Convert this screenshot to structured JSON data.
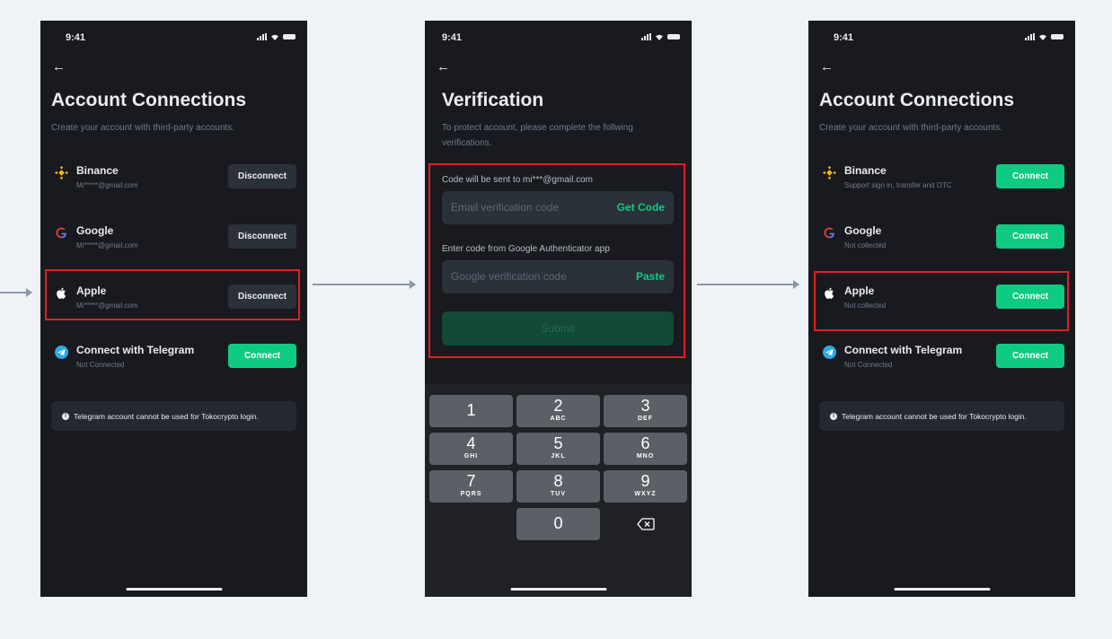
{
  "status_time": "9:41",
  "connections": {
    "title": "Account Connections",
    "subtitle": "Create your account with third-party accounts.",
    "notice": "Telegram account cannot be used for Tokocrypto login."
  },
  "screen1": {
    "accounts": [
      {
        "name": "Binance",
        "detail": "Mi*****@gmail.com",
        "button": "Disconnect",
        "icon": "binance-icon"
      },
      {
        "name": "Google",
        "detail": "Mi*****@gmail.com",
        "button": "Disconnect",
        "icon": "google-icon"
      },
      {
        "name": "Apple",
        "detail": "Mi*****@gmail.com",
        "button": "Disconnect",
        "icon": "apple-icon"
      },
      {
        "name": "Connect with Telegram",
        "detail": "Not Connected",
        "button": "Connect",
        "icon": "telegram-icon"
      }
    ]
  },
  "screen2": {
    "title": "Verification",
    "subtitle": "To protect account, please complete the follwing verifications.",
    "email_label": "Code will be sent to mi***@gmail.com",
    "email_placeholder": "Email verification code",
    "email_action": "Get Code",
    "google_label": "Enter code from Google Authenticator app",
    "google_placeholder": "Google verification code",
    "google_action": "Paste",
    "submit": "Submit",
    "keys": [
      {
        "digit": "1",
        "letters": ""
      },
      {
        "digit": "2",
        "letters": "ABC"
      },
      {
        "digit": "3",
        "letters": "DEF"
      },
      {
        "digit": "4",
        "letters": "GHI"
      },
      {
        "digit": "5",
        "letters": "JKL"
      },
      {
        "digit": "6",
        "letters": "MNO"
      },
      {
        "digit": "7",
        "letters": "PQRS"
      },
      {
        "digit": "8",
        "letters": "TUV"
      },
      {
        "digit": "9",
        "letters": "WXYZ"
      },
      {
        "digit": "0",
        "letters": ""
      }
    ]
  },
  "screen3": {
    "accounts": [
      {
        "name": "Binance",
        "detail": "Support sign in, transfer and OTC",
        "button": "Connect",
        "icon": "binance-icon"
      },
      {
        "name": "Google",
        "detail": "Not collected",
        "button": "Connect",
        "icon": "google-icon"
      },
      {
        "name": "Apple",
        "detail": "Not collected",
        "button": "Connect",
        "icon": "apple-icon"
      },
      {
        "name": "Connect with Telegram",
        "detail": "Not Connected",
        "button": "Connect",
        "icon": "telegram-icon"
      }
    ]
  },
  "colors": {
    "background": "#eff3f7",
    "screen": "#181a20",
    "accent_green": "#0ecb81",
    "highlight_red": "#e31e24",
    "binance_yellow": "#f0b90b",
    "telegram_blue": "#2aabee"
  }
}
